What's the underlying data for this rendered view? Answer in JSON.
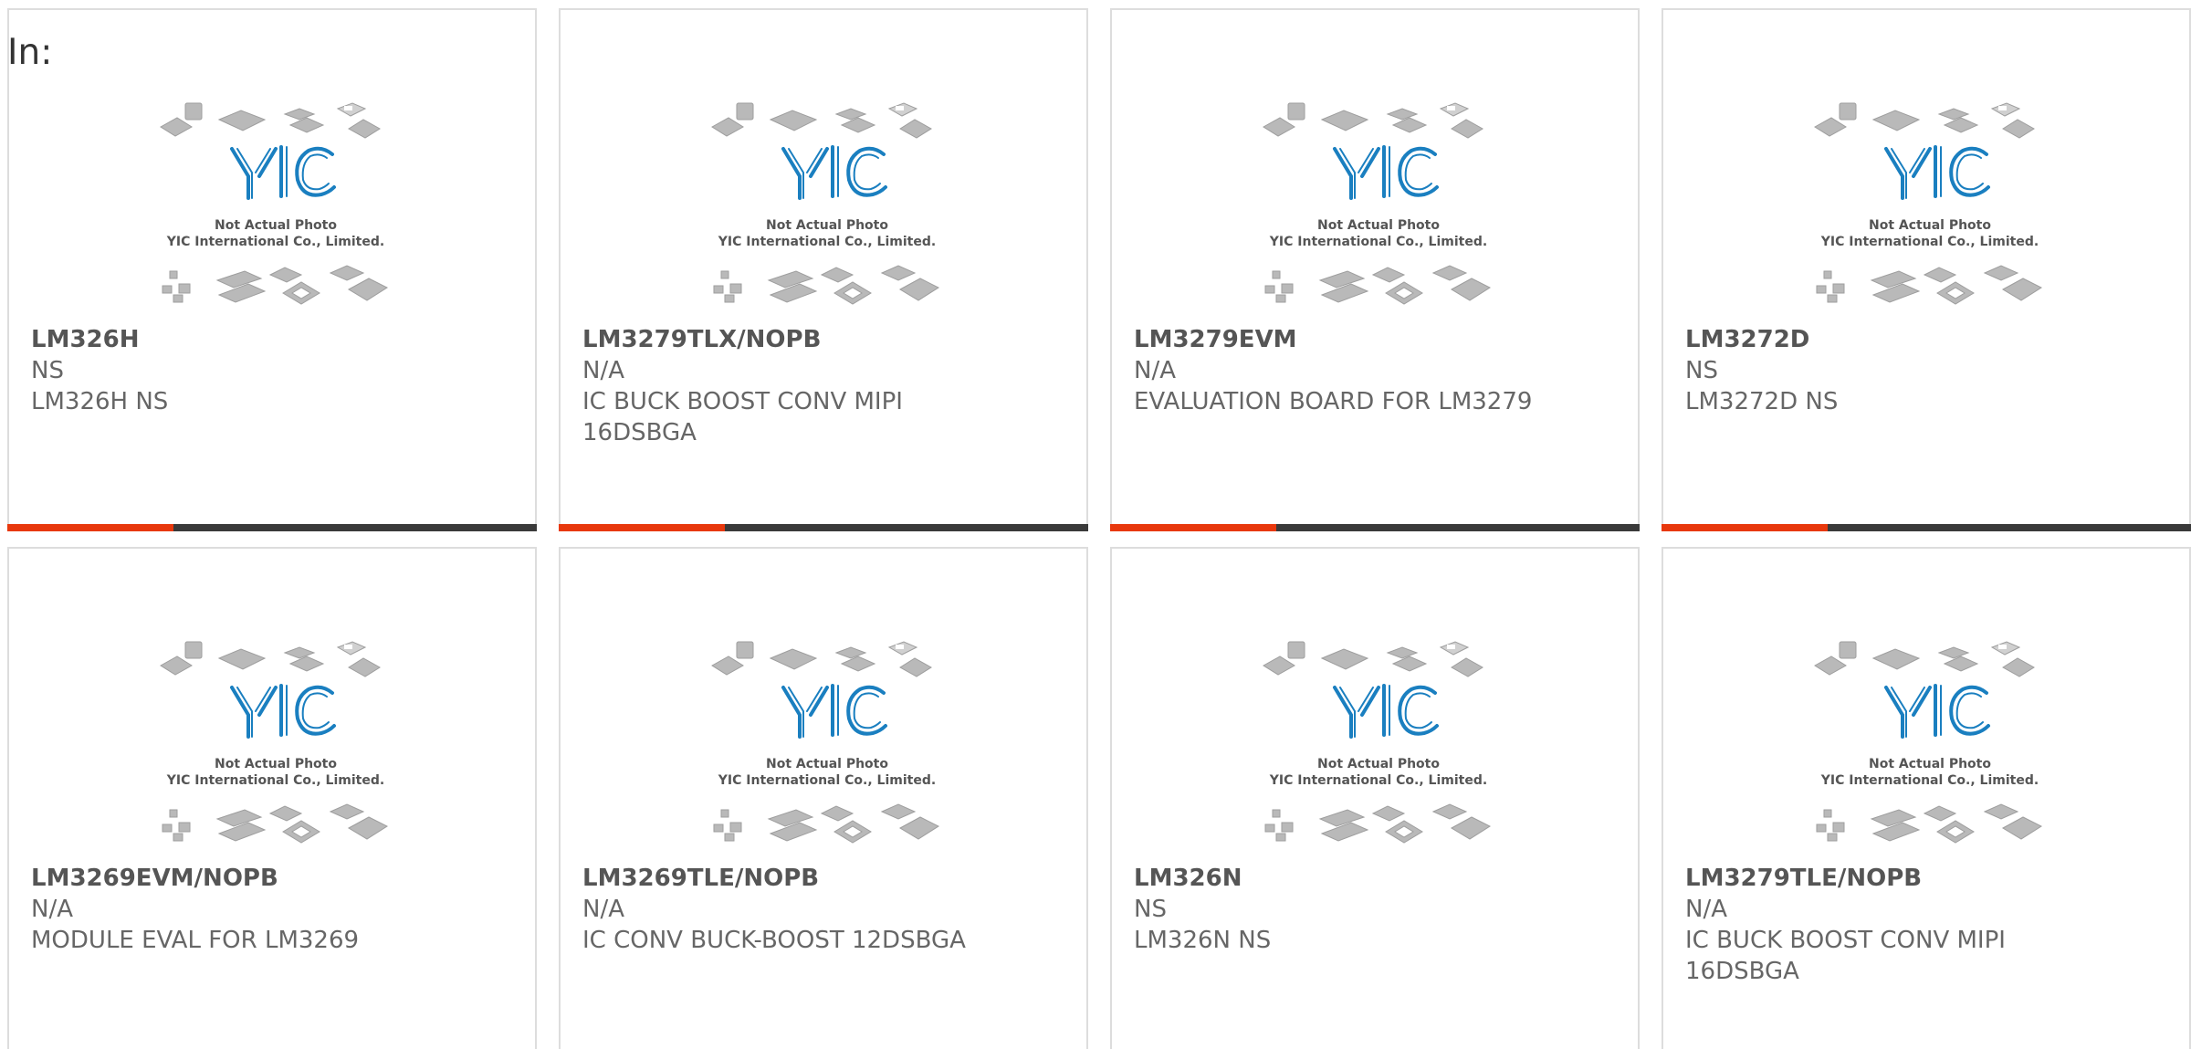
{
  "header": {
    "label": "In:"
  },
  "placeholder": {
    "line1": "Not Actual Photo",
    "line2": "YIC International Co., Limited.",
    "logo_text": "YIC"
  },
  "colors": {
    "accent": "#e8380d",
    "bar": "#3a3a3a",
    "logo": "#1a7fc0"
  },
  "products": [
    {
      "part": "LM326H",
      "mfr": "NS",
      "desc": "LM326H NS"
    },
    {
      "part": "LM3279TLX/NOPB",
      "mfr": "N/A",
      "desc": "IC BUCK BOOST CONV MIPI 16DSBGA"
    },
    {
      "part": "LM3279EVM",
      "mfr": "N/A",
      "desc": "EVALUATION BOARD FOR LM3279"
    },
    {
      "part": "LM3272D",
      "mfr": "NS",
      "desc": "LM3272D NS"
    },
    {
      "part": "LM3269EVM/NOPB",
      "mfr": "N/A",
      "desc": "MODULE EVAL FOR LM3269"
    },
    {
      "part": "LM3269TLE/NOPB",
      "mfr": "N/A",
      "desc": "IC CONV BUCK-BOOST 12DSBGA"
    },
    {
      "part": "LM326N",
      "mfr": "NS",
      "desc": "LM326N NS"
    },
    {
      "part": "LM3279TLE/NOPB",
      "mfr": "N/A",
      "desc": "IC BUCK BOOST CONV MIPI 16DSBGA"
    }
  ]
}
